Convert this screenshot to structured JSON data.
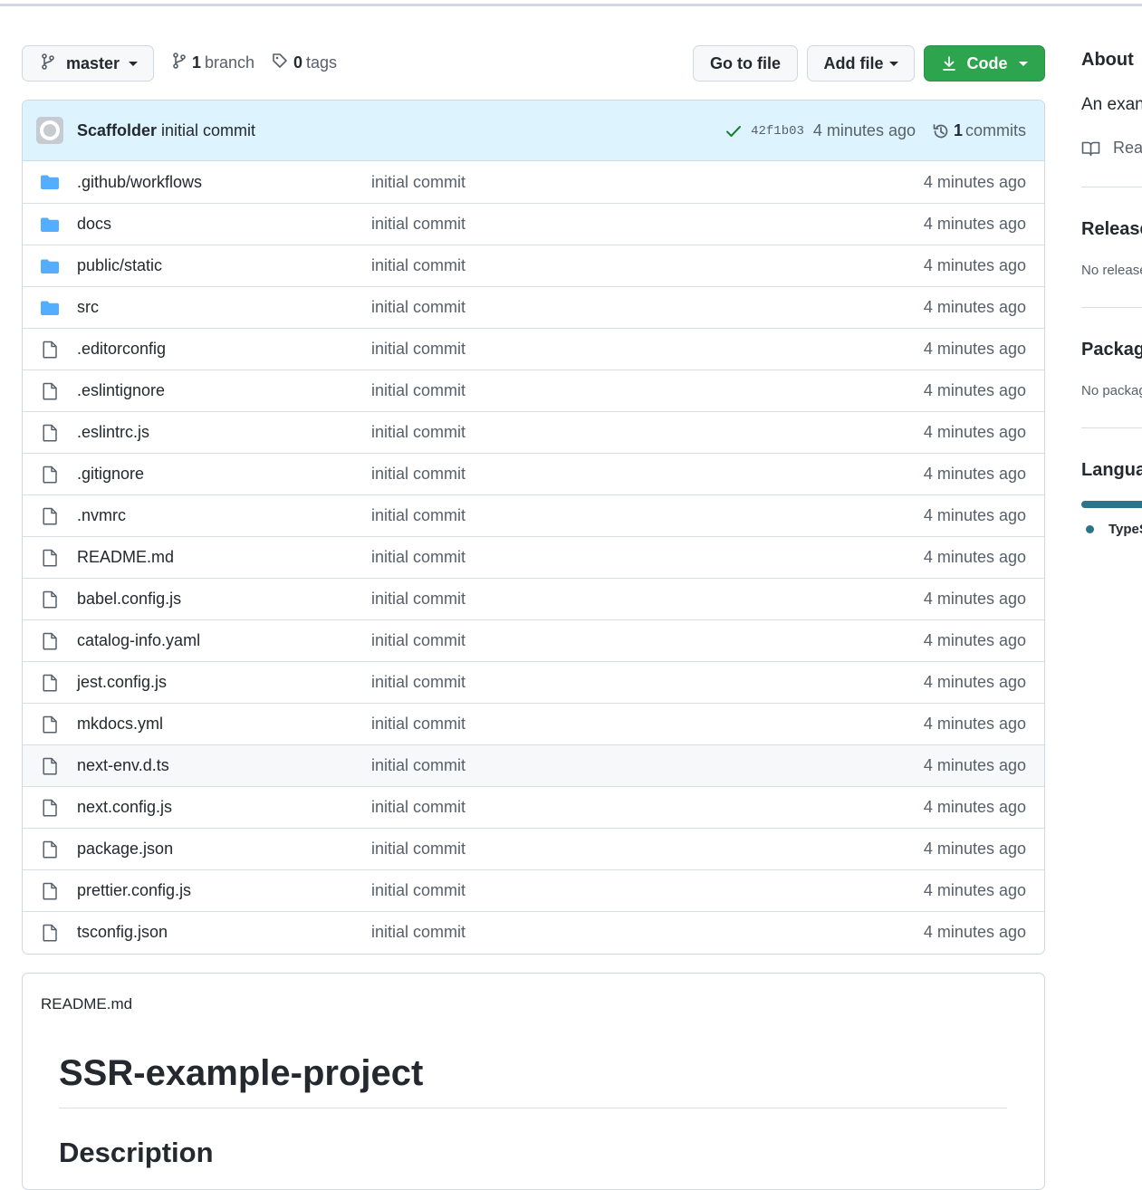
{
  "toolbar": {
    "branch": "master",
    "branch_count": "1",
    "branch_label": "branch",
    "tag_count": "0",
    "tag_label": "tags",
    "go_to_file": "Go to file",
    "add_file": "Add file",
    "code": "Code"
  },
  "commit": {
    "author": "Scaffolder",
    "message": "initial commit",
    "sha": "42f1b03",
    "time": "4 minutes ago",
    "commit_count": "1",
    "commit_label": "commits"
  },
  "files": [
    {
      "name": ".github/workflows",
      "type": "folder",
      "message": "initial commit",
      "age": "4 minutes ago"
    },
    {
      "name": "docs",
      "type": "folder",
      "message": "initial commit",
      "age": "4 minutes ago"
    },
    {
      "name": "public/static",
      "type": "folder",
      "message": "initial commit",
      "age": "4 minutes ago"
    },
    {
      "name": "src",
      "type": "folder",
      "message": "initial commit",
      "age": "4 minutes ago"
    },
    {
      "name": ".editorconfig",
      "type": "file",
      "message": "initial commit",
      "age": "4 minutes ago"
    },
    {
      "name": ".eslintignore",
      "type": "file",
      "message": "initial commit",
      "age": "4 minutes ago"
    },
    {
      "name": ".eslintrc.js",
      "type": "file",
      "message": "initial commit",
      "age": "4 minutes ago"
    },
    {
      "name": ".gitignore",
      "type": "file",
      "message": "initial commit",
      "age": "4 minutes ago"
    },
    {
      "name": ".nvmrc",
      "type": "file",
      "message": "initial commit",
      "age": "4 minutes ago"
    },
    {
      "name": "README.md",
      "type": "file",
      "message": "initial commit",
      "age": "4 minutes ago"
    },
    {
      "name": "babel.config.js",
      "type": "file",
      "message": "initial commit",
      "age": "4 minutes ago"
    },
    {
      "name": "catalog-info.yaml",
      "type": "file",
      "message": "initial commit",
      "age": "4 minutes ago"
    },
    {
      "name": "jest.config.js",
      "type": "file",
      "message": "initial commit",
      "age": "4 minutes ago"
    },
    {
      "name": "mkdocs.yml",
      "type": "file",
      "message": "initial commit",
      "age": "4 minutes ago"
    },
    {
      "name": "next-env.d.ts",
      "type": "file",
      "message": "initial commit",
      "age": "4 minutes ago",
      "hovered": true
    },
    {
      "name": "next.config.js",
      "type": "file",
      "message": "initial commit",
      "age": "4 minutes ago"
    },
    {
      "name": "package.json",
      "type": "file",
      "message": "initial commit",
      "age": "4 minutes ago"
    },
    {
      "name": "prettier.config.js",
      "type": "file",
      "message": "initial commit",
      "age": "4 minutes ago"
    },
    {
      "name": "tsconfig.json",
      "type": "file",
      "message": "initial commit",
      "age": "4 minutes ago"
    }
  ],
  "readme": {
    "filename": "README.md",
    "title": "SSR-example-project",
    "heading": "Description"
  },
  "sidebar": {
    "about_title": "About",
    "about_text": "An exan",
    "readme_link": "Read",
    "releases_title": "Release",
    "releases_text": "No release",
    "packages_title": "Package",
    "packages_text": "No packag",
    "languages_title": "Langua",
    "language_name": "TypeS",
    "language_color": "#3178c6",
    "language_bar_color": "#2b7489"
  },
  "colors": {
    "green": "#2da44e",
    "folder": "#54aeff",
    "commit_bar": "#ddf4ff",
    "check": "#1a7f37"
  }
}
